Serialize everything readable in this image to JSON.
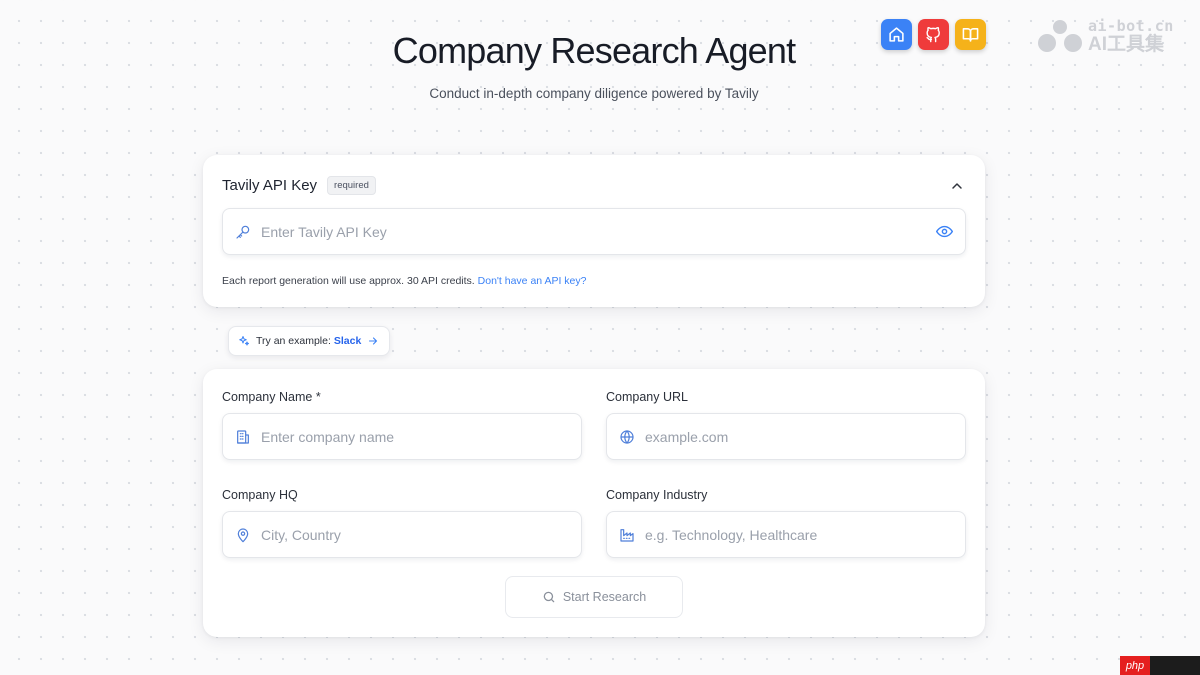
{
  "header": {
    "title": "Company Research Agent",
    "subtitle": "Conduct in-depth company diligence powered by Tavily"
  },
  "top_links": [
    {
      "icon": "home-icon",
      "color": "#3b82f6"
    },
    {
      "icon": "github-icon",
      "color": "#ef3b3b"
    },
    {
      "icon": "book-icon",
      "color": "#f5b21a"
    }
  ],
  "watermark": {
    "line1": "ai-bot.cn",
    "line2": "AI工具集"
  },
  "api_key": {
    "title": "Tavily API Key",
    "badge": "required",
    "placeholder": "Enter Tavily API Key",
    "value": "",
    "note": "Each report generation will use approx. 30 API credits.",
    "link": "Don't have an API key?"
  },
  "example": {
    "prefix": "Try an example:",
    "name": "Slack"
  },
  "form": {
    "company_name": {
      "label": "Company Name",
      "required_mark": "*",
      "placeholder": "Enter company name",
      "value": ""
    },
    "company_url": {
      "label": "Company URL",
      "placeholder": "example.com",
      "value": ""
    },
    "company_hq": {
      "label": "Company HQ",
      "placeholder": "City, Country",
      "value": ""
    },
    "company_industry": {
      "label": "Company Industry",
      "placeholder": "e.g. Technology, Healthcare",
      "value": ""
    },
    "submit_label": "Start Research"
  },
  "footer_badge": {
    "text": "php"
  },
  "colors": {
    "accent": "#3b82f6",
    "link": "#3b82f6",
    "icon_blue": "#4f7fd9"
  }
}
